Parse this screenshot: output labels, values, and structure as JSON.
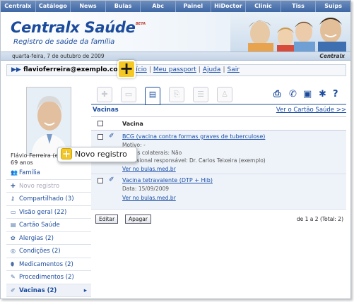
{
  "topnav": [
    "Centralx",
    "Catálogo",
    "News",
    "Bulas",
    "Abc",
    "Painel",
    "HiDoctor",
    "Clinic",
    "Tiss",
    "Suips"
  ],
  "header": {
    "logo": "Centralx Saúde",
    "beta": "BETA",
    "tagline": "Registro de saúde da família",
    "date": "quarta-feira, 7 de outubro de 2009",
    "brand": "Centralx"
  },
  "userbar": {
    "email": "flavioferreira@exemplo.com",
    "links": [
      "Início",
      "Meu passport",
      "Ajuda",
      "Sair"
    ]
  },
  "profile": {
    "name": "Flávio Ferreira (e",
    "age": "69 anos"
  },
  "menu": [
    {
      "label": "Família",
      "icon": "people-icon"
    },
    {
      "label": "Novo registro",
      "icon": "plus-icon"
    },
    {
      "label": "Compartilhado (3)",
      "icon": "key-icon"
    },
    {
      "label": "Visão geral (22)",
      "icon": "folder-icon"
    },
    {
      "label": "Cartão Saúde",
      "icon": "card-icon"
    },
    {
      "label": "Alergias (2)",
      "icon": "allergy-icon"
    },
    {
      "label": "Condições (2)",
      "icon": "condition-icon"
    },
    {
      "label": "Medicamentos (2)",
      "icon": "pill-icon"
    },
    {
      "label": "Procedimentos (2)",
      "icon": "procedure-icon"
    },
    {
      "label": "Vacinas (2)",
      "icon": "syringe-icon"
    }
  ],
  "main": {
    "section_title": "Vacinas",
    "card_link": "Ver o Cartão Saúde >>",
    "column_header": "Vacina",
    "rows": [
      {
        "title": "BCG (vacina contra formas graves de tuberculose)",
        "lines": [
          "Motivo: -",
          "Efeitos colaterais: Não",
          "Profissional responsável: Dr. Carlos Teixeira (exemplo)"
        ],
        "more": "Ver no bulas.med.br"
      },
      {
        "title": "Vacina tetravalente (DTP + Hib)",
        "lines": [
          "Data: 15/09/2009"
        ],
        "more": "Ver no bulas.med.br"
      }
    ],
    "edit_button": "Editar",
    "delete_button": "Apagar",
    "paging": "de 1 a 2 (Total: 2)"
  },
  "callout": {
    "new_record": "Novo registro"
  },
  "colors": {
    "accent": "#1b4b9c",
    "highlight": "#f6c823"
  }
}
